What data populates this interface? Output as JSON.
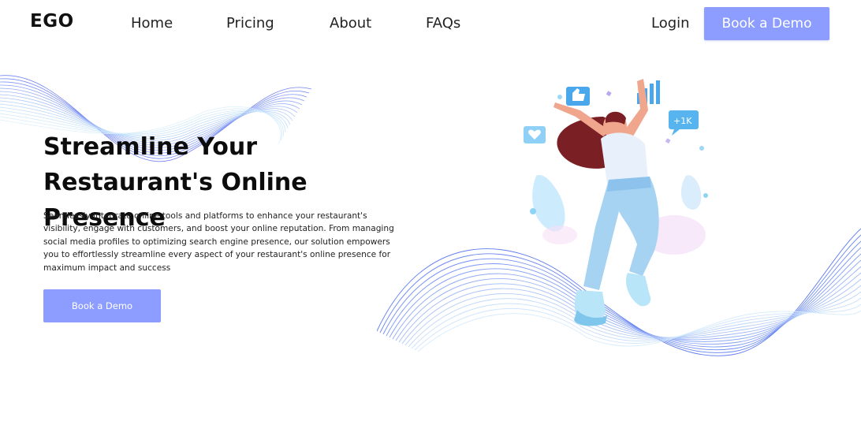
{
  "brand": {
    "logo_text": "EGO"
  },
  "nav": {
    "items": [
      {
        "label": "Home"
      },
      {
        "label": "Pricing"
      },
      {
        "label": "About"
      },
      {
        "label": "FAQs"
      }
    ],
    "login_label": "Login",
    "cta_label": "Book a Demo"
  },
  "hero": {
    "title": "Streamline Your Restaurant's Online Presence",
    "description": "Seamlessly integrate online tools and platforms to enhance your restaurant's visibility, engage with customers, and boost your online reputation. From managing social media profiles to optimizing search engine presence, our solution empowers you to effortlessly streamline every aspect of your restaurant's online presence for maximum impact and success",
    "cta_label": "Book a Demo"
  },
  "illustration": {
    "badge_text": "+1K"
  },
  "colors": {
    "accent": "#8c9cff",
    "wave_blue": "#6a86f5",
    "wave_light": "#a9d6f5",
    "hair": "#7a1f24",
    "skin": "#f0a58d"
  }
}
